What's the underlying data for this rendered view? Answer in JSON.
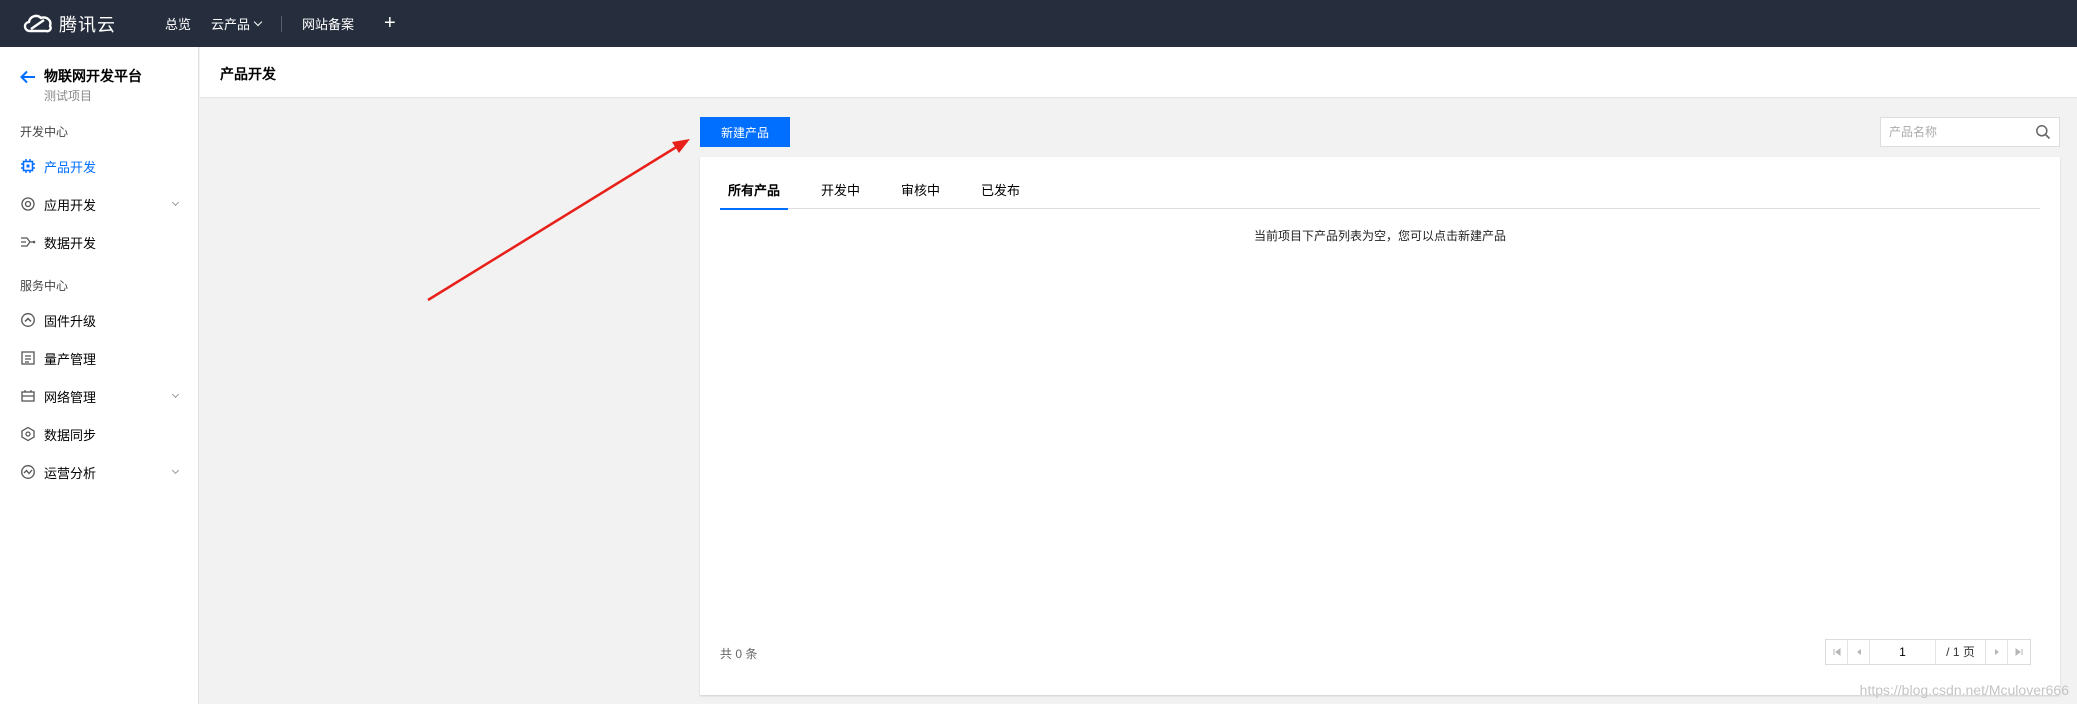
{
  "topbar": {
    "brand": "腾讯云",
    "nav": [
      "总览",
      "云产品",
      "网站备案"
    ],
    "plus": "+"
  },
  "sidebar": {
    "project_title": "物联网开发平台",
    "project_sub": "测试项目",
    "section1": "开发中心",
    "section2": "服务中心",
    "items": [
      {
        "label": "产品开发",
        "icon": "chip-icon",
        "active": true
      },
      {
        "label": "应用开发",
        "icon": "gear-icon",
        "expandable": true
      },
      {
        "label": "数据开发",
        "icon": "data-flow-icon"
      },
      {
        "label": "固件升级",
        "icon": "upgrade-icon"
      },
      {
        "label": "量产管理",
        "icon": "document-icon"
      },
      {
        "label": "网络管理",
        "icon": "network-icon",
        "expandable": true
      },
      {
        "label": "数据同步",
        "icon": "sync-icon"
      },
      {
        "label": "运营分析",
        "icon": "analytics-icon",
        "expandable": true
      }
    ]
  },
  "page": {
    "title": "产品开发",
    "new_button": "新建产品",
    "search_placeholder": "产品名称",
    "tabs": [
      "所有产品",
      "开发中",
      "审核中",
      "已发布"
    ],
    "active_tab": "所有产品",
    "empty_text": "当前项目下产品列表为空，您可以点击新建产品",
    "total": "共 0 条",
    "pager": {
      "current": "1",
      "total": "/ 1 页"
    }
  },
  "watermark": "https://blog.csdn.net/Mculover666",
  "colors": {
    "accent": "#006eff",
    "topbar": "#262e3d",
    "annotation_arrow": "#e8201a"
  }
}
